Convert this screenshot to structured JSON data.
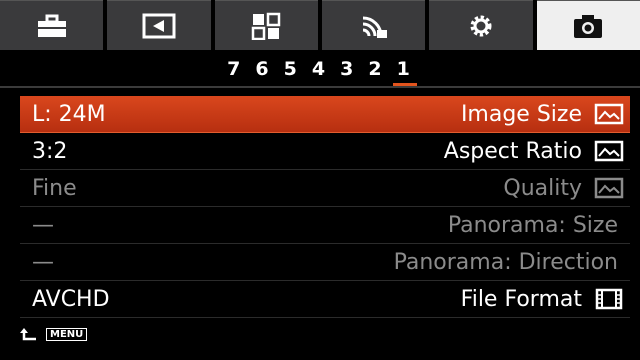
{
  "tabs": [
    {
      "name": "toolbox-icon"
    },
    {
      "name": "playback-icon"
    },
    {
      "name": "grid-icon"
    },
    {
      "name": "wireless-icon"
    },
    {
      "name": "gear-icon"
    },
    {
      "name": "camera-icon"
    }
  ],
  "pages": [
    "1",
    "2",
    "3",
    "4",
    "5",
    "6",
    "7"
  ],
  "current_page": "1",
  "menu": [
    {
      "label": "Image Size",
      "value": "L: 24M",
      "icon": "image-icon",
      "state": "selected"
    },
    {
      "label": "Aspect Ratio",
      "value": "3:2",
      "icon": "image-icon",
      "state": "normal"
    },
    {
      "label": "Quality",
      "value": "Fine",
      "icon": "image-icon",
      "state": "dim"
    },
    {
      "label": "Panorama: Size",
      "value": "—",
      "icon": "",
      "state": "dim"
    },
    {
      "label": "Panorama: Direction",
      "value": "—",
      "icon": "",
      "state": "dim"
    },
    {
      "label": "File Format",
      "value": "AVCHD",
      "icon": "film-icon",
      "state": "normal"
    }
  ],
  "footer": {
    "menu_label": "MENU"
  },
  "colors": {
    "accent": "#d9471d",
    "tab_bg": "#3a3a3c",
    "tab_active": "#efefef"
  }
}
